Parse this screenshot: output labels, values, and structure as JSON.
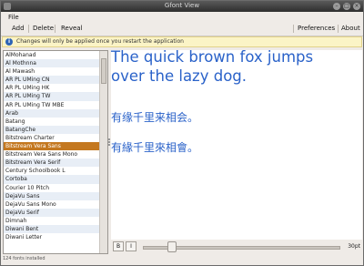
{
  "window": {
    "title": "Gfont View"
  },
  "titlebar_icons": {
    "minimize": "min-icon",
    "maximize": "max-icon",
    "close": "close-icon"
  },
  "menu": {
    "file": "File"
  },
  "toolbar": {
    "add": "Add",
    "delete": "Delete",
    "reveal": "Reveal",
    "preferences": "Preferences",
    "about": "About"
  },
  "infobar": {
    "icon": "info-icon",
    "text": "Changes will only be applied once you restart the application"
  },
  "fonts": [
    "AlMohanad",
    "Al Mothnna",
    "Al Mawash",
    "AR PL UMing CN",
    "AR PL UMing HK",
    "AR PL UMing TW",
    "AR PL UMing TW MBE",
    "Arab",
    "Batang",
    "BatangChe",
    "Bitstream Charter",
    "Bitstream Vera Sans",
    "Bitstream Vera Sans Mono",
    "Bitstream Vera Serif",
    "Century Schoolbook L",
    "Cortoba",
    "Courier 10 Pitch",
    "DejaVu Sans",
    "DejaVu Sans Mono",
    "DejaVu Serif",
    "Dimnah",
    "Diwani Bent",
    "Diwani Letter"
  ],
  "selected_font": "Bitstream Vera Sans",
  "status": {
    "count_text": "124 fonts installed"
  },
  "preview": {
    "line1": "The quick brown fox jumps",
    "line2": "over the lazy dog.",
    "cjk_simplified": "有缘千里来相会。",
    "cjk_traditional": "有緣千里來相會。"
  },
  "controls": {
    "bold_label": "B",
    "italic_label": "I",
    "size_value": 30,
    "size_min": 0,
    "size_max": 200,
    "size_label": "30pt"
  }
}
